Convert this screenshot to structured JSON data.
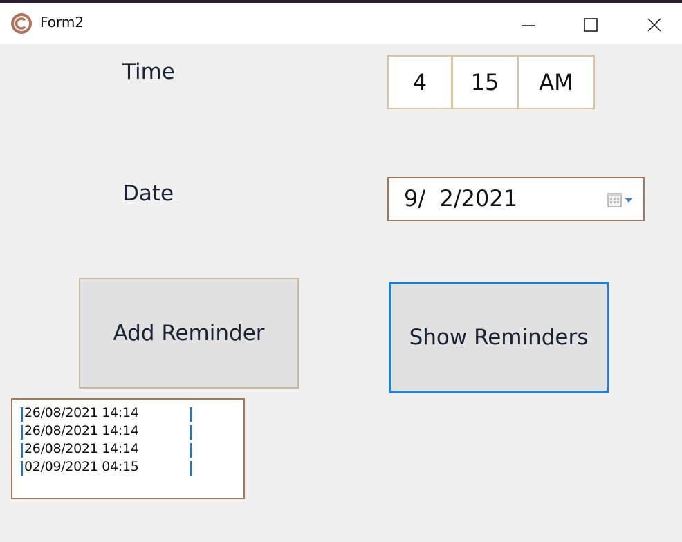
{
  "window": {
    "title": "Form2",
    "icon": "app-c-icon",
    "controls": [
      "minimize-icon",
      "maximize-icon",
      "close-icon"
    ]
  },
  "labels": {
    "time": "Time",
    "date": "Date"
  },
  "time_picker": {
    "hour": "4",
    "minute": "15",
    "ampm": "AM"
  },
  "date_picker": {
    "value": "9/  2/2021",
    "icon": "calendar-dropdown-icon"
  },
  "buttons": {
    "add": "Add Reminder",
    "show": "Show Reminders"
  },
  "reminders": [
    "26/08/2021 14:14",
    "26/08/2021 14:14",
    "26/08/2021 14:14",
    "02/09/2021 04:15"
  ],
  "colors": {
    "accent_border": "#1e7fd8",
    "icon_brown": "#b0735a"
  }
}
